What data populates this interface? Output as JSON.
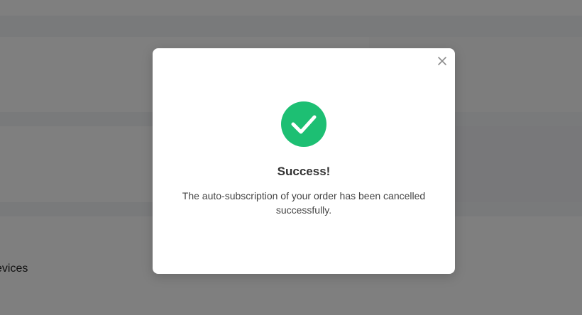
{
  "background": {
    "partial_text": "evices"
  },
  "modal": {
    "title": "Success!",
    "message": "The auto-subscription of your order has been cancelled successfully.",
    "close_icon": "close-icon",
    "status_icon": "check-circle-icon",
    "accent_color": "#1dbf73"
  }
}
